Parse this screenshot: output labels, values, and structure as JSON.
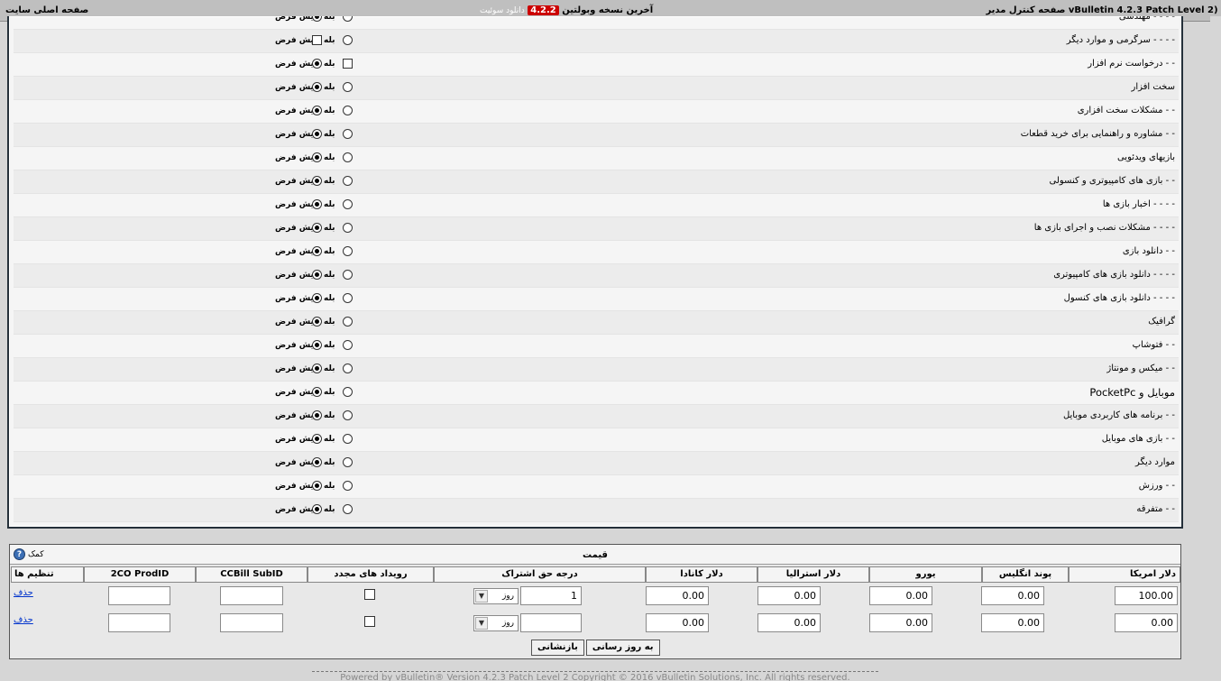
{
  "topbar": {
    "control_panel": "vBulletin 4.2.3 Patch Level 2) ‎ ‏‏صفحه کنترل مدیر",
    "latest_label": "آخرین نسخه وبولتین",
    "latest_version": "4.2.2",
    "download_label": "دانلود سوئیت",
    "home_label": "صفحه اصلی سایت"
  },
  "forum_rows": [
    {
      "label": "- - - - مهندسی",
      "state": "default"
    },
    {
      "label": "- - - - سرگرمی و موارد دیگر",
      "state": "checkbox_yes"
    },
    {
      "label": "- - درخواست نرم افزار",
      "state": "default_checkbox"
    },
    {
      "label": "سخت افزار",
      "state": "default"
    },
    {
      "label": "- - مشکلات سخت افزاری",
      "state": "default"
    },
    {
      "label": "- - مشاوره و راهنمایی برای خرید قطعات",
      "state": "default"
    },
    {
      "label": "بازیهای ویدئویی",
      "state": "default"
    },
    {
      "label": "- - بازی های کامپیوتری و کنسولی",
      "state": "default"
    },
    {
      "label": "- - - - اخبار بازی ها",
      "state": "default"
    },
    {
      "label": "- - - - مشکلات نصب و اجرای بازی ها",
      "state": "default"
    },
    {
      "label": "- - دانلود بازی",
      "state": "default"
    },
    {
      "label": "- - - - دانلود بازی های کامپیوتری",
      "state": "default"
    },
    {
      "label": "- - - - دانلود بازی های کنسول",
      "state": "default"
    },
    {
      "label": "گرافیک",
      "state": "default"
    },
    {
      "label": "- - فتوشاپ",
      "state": "default"
    },
    {
      "label": "- - میکس و مونتاژ",
      "state": "default"
    },
    {
      "label": "موبایل و PocketPc",
      "state": "default",
      "big": true
    },
    {
      "label": "- - برنامه های کاربردی موبایل",
      "state": "default"
    },
    {
      "label": "- - بازی های موبایل",
      "state": "default"
    },
    {
      "label": "موارد دیگر",
      "state": "default"
    },
    {
      "label": "- - ورزش",
      "state": "default"
    },
    {
      "label": "- - متفرقه",
      "state": "default"
    }
  ],
  "option_labels": {
    "yes": "بله",
    "default": "پیش فرض"
  },
  "price": {
    "title": "قیمت",
    "help": "کمک",
    "columns": [
      "دلار امریکا",
      "پوند انگلیس",
      "یورو",
      "دلار استرالیا",
      "دلار کانادا",
      "درجه حق اشتراک",
      "رویداد های مجدد",
      "CCBill SubID",
      "2CO ProdID",
      "تنظیم ها"
    ],
    "rows": [
      {
        "usd": "100.00",
        "gbp": "0.00",
        "eur": "0.00",
        "aud": "0.00",
        "cad": "0.00",
        "length": "1",
        "unit": "روز",
        "recurring": false,
        "ccbill": "",
        "twoco": "",
        "action": "حذف"
      },
      {
        "usd": "0.00",
        "gbp": "0.00",
        "eur": "0.00",
        "aud": "0.00",
        "cad": "0.00",
        "length": "",
        "unit": "روز",
        "recurring": false,
        "ccbill": "",
        "twoco": "",
        "action": "حذف"
      }
    ],
    "update_button": "به روز رسانی",
    "reset_button": "بازنشانی"
  },
  "footer": "Powered by vBulletin® Version 4.2.3 Patch Level 2 Copyright © 2016 vBulletin Solutions, Inc. All rights reserved."
}
